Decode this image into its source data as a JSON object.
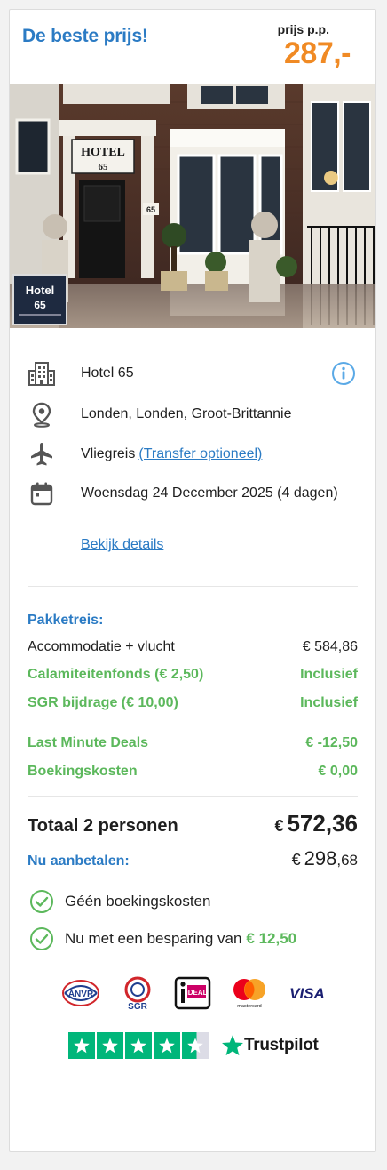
{
  "header": {
    "best_price": "De beste prijs!",
    "pp_label": "prijs p.p.",
    "price": "287,-"
  },
  "hotel_photo": {
    "sign_line1": "HOTEL",
    "sign_line2": "65",
    "plate_line1": "Hotel",
    "plate_line2": "65",
    "house_number": "65"
  },
  "info": {
    "hotel_name": "Hotel 65",
    "location": "Londen, Londen, Groot-Brittannie",
    "travel_type": "Vliegreis",
    "transfer_link": "(Transfer optioneel)",
    "date": "Woensdag 24 December 2025 (4 dagen)",
    "details_link": "Bekijk details",
    "icons": [
      "hotel-building-icon",
      "location-pin-icon",
      "airplane-icon",
      "calendar-icon",
      "info-circle-icon"
    ]
  },
  "breakdown": {
    "package_label": "Pakketreis:",
    "accommodation_label": "Accommodatie + vlucht",
    "accommodation_value": "€ 584,86",
    "calamity_label": "Calamiteitenfonds (€ 2,50)",
    "calamity_value": "Inclusief",
    "sgr_label": "SGR bijdrage (€ 10,00)",
    "sgr_value": "Inclusief",
    "lastminute_label": "Last Minute Deals",
    "lastminute_value": "€ -12,50",
    "booking_label": "Boekingskosten",
    "booking_value": "€ 0,00"
  },
  "total": {
    "label": "Totaal 2 personen",
    "currency": "€",
    "amount": "572,36",
    "pay_now_label": "Nu aanbetalen:",
    "pay_currency": "€",
    "pay_whole": "298",
    "pay_cents": ",68"
  },
  "benefits": {
    "no_costs": "Géén boekingskosten",
    "savings_prefix": "Nu met een besparing van",
    "savings_amount": "€ 12,50"
  },
  "payment_logos": {
    "anvr": "ANVR",
    "sgr": "SGR",
    "ideal": "iDEAL",
    "mastercard": "mastercard",
    "visa": "VISA"
  },
  "trustpilot": {
    "brand": "Trustpilot",
    "stars": 4.5
  },
  "colors": {
    "blue": "#2b7bc4",
    "orange": "#f08a24",
    "green": "#5cb85c",
    "trustpilot": "#00b67a"
  }
}
